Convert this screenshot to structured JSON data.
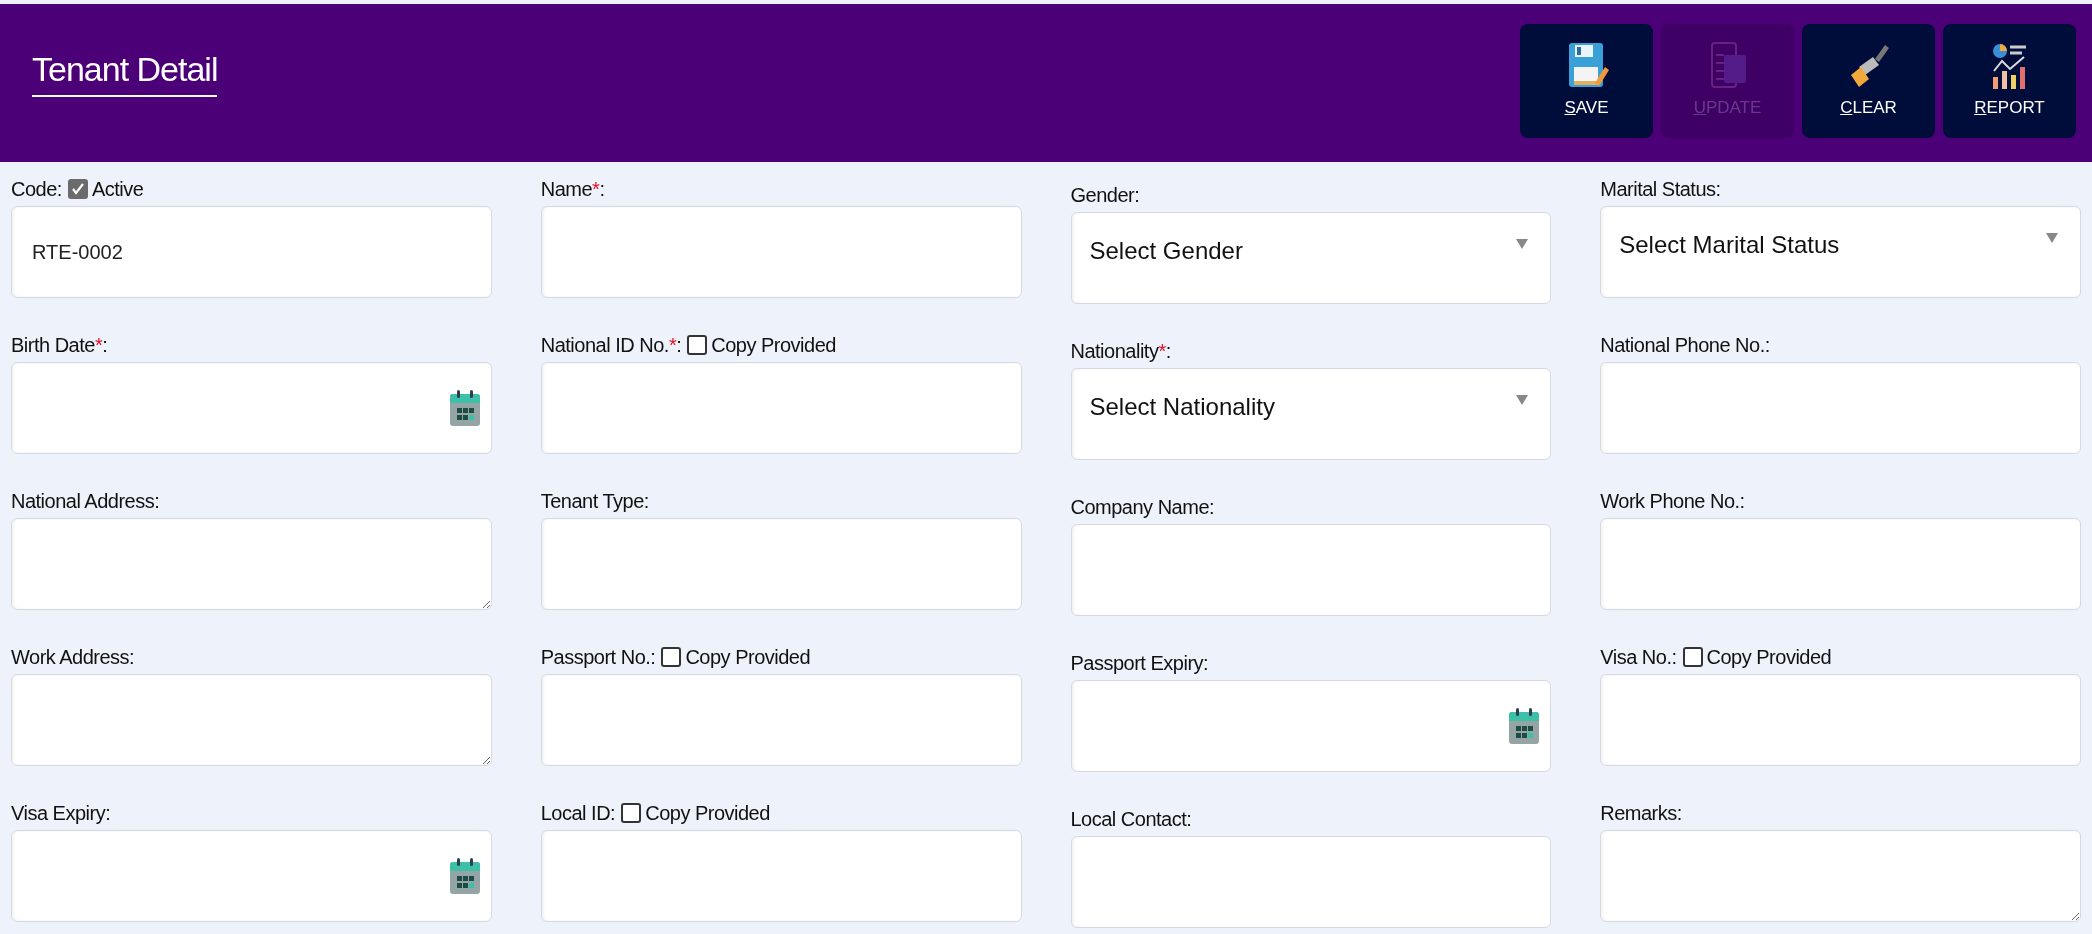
{
  "header": {
    "title": "Tenant Detail",
    "buttons": [
      {
        "access": "S",
        "rest": "AVE",
        "disabled": false
      },
      {
        "access": "U",
        "rest": "PDATE",
        "disabled": true
      },
      {
        "access": "C",
        "rest": "LEAR",
        "disabled": false
      },
      {
        "access": "R",
        "rest": "EPORT",
        "disabled": false
      }
    ]
  },
  "rows": [
    [
      {
        "label": "Code:",
        "kind": "text",
        "checkbox": {
          "label": "Active",
          "checked": true
        },
        "value": "RTE-0002"
      },
      {
        "label": "Name",
        "mark": "*",
        "label_end": ":",
        "kind": "text"
      },
      {
        "label": "Gender:",
        "kind": "select",
        "placeholder": "Select Gender"
      },
      {
        "label": "Marital Status:",
        "kind": "select",
        "placeholder": "Select Marital Status"
      }
    ],
    [
      {
        "label": "Birth Date",
        "mark": "*",
        "label_end": ":",
        "kind": "date"
      },
      {
        "label": "National ID No.",
        "mark": "*",
        "label_end": ":",
        "kind": "text",
        "checkbox": {
          "label": "Copy Provided",
          "checked": false
        }
      },
      {
        "label": "Nationality",
        "mark": "*",
        "label_end": ":",
        "kind": "select",
        "placeholder": "Select Nationality"
      },
      {
        "label": "National Phone No.:",
        "kind": "text"
      }
    ],
    [
      {
        "label": "National Address:",
        "kind": "textarea"
      },
      {
        "label": "Tenant Type:",
        "kind": "text"
      },
      {
        "label": "Company Name:",
        "kind": "text"
      },
      {
        "label": "Work Phone No.:",
        "kind": "text"
      }
    ],
    [
      {
        "label": "Work Address:",
        "kind": "textarea"
      },
      {
        "label": "Passport No.:",
        "kind": "text",
        "checkbox": {
          "label": "Copy Provided",
          "checked": false
        }
      },
      {
        "label": "Passport Expiry:",
        "kind": "date"
      },
      {
        "label": "Visa No.:",
        "kind": "text",
        "checkbox": {
          "label": "Copy Provided",
          "checked": false
        }
      }
    ],
    [
      {
        "label": "Visa Expiry:",
        "kind": "date"
      },
      {
        "label": "Local ID:",
        "kind": "text",
        "checkbox": {
          "label": "Copy Provided",
          "checked": false
        }
      },
      {
        "label": "Local Contact:",
        "kind": "text"
      },
      {
        "label": "Remarks:",
        "kind": "textarea"
      }
    ]
  ]
}
